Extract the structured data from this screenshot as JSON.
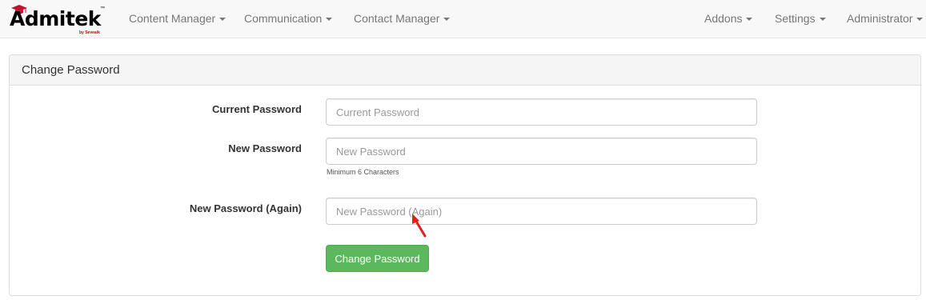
{
  "brand": {
    "name": "Admitek",
    "tm": "™",
    "byline": "by Seveaik"
  },
  "nav": {
    "left": [
      {
        "label": "Content Manager"
      },
      {
        "label": "Communication"
      },
      {
        "label": "Contact Manager"
      }
    ],
    "right": [
      {
        "label": "Addons"
      },
      {
        "label": "Settings"
      },
      {
        "label": "Administrator"
      }
    ]
  },
  "panel": {
    "title": "Change Password"
  },
  "form": {
    "current": {
      "label": "Current Password",
      "placeholder": "Current Password",
      "value": ""
    },
    "new": {
      "label": "New Password",
      "placeholder": "New Password",
      "value": "",
      "help": "Minimum 6 Characters"
    },
    "again": {
      "label": "New Password (Again)",
      "placeholder": "New Password (Again)",
      "value": ""
    },
    "submit_label": "Change Password"
  },
  "colors": {
    "submit": "#5cb85c",
    "arrow": "#e02020"
  },
  "icons": {
    "logo_cap": "graduation-cap-icon",
    "dropdown": "caret-down-icon",
    "annotation": "red-arrow-icon"
  }
}
